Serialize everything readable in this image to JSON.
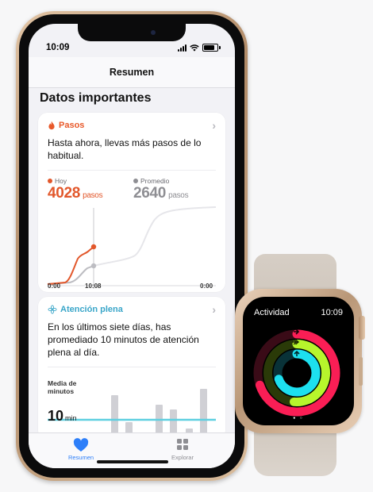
{
  "phone": {
    "status_bar": {
      "time": "10:09"
    },
    "nav_title": "Resumen",
    "section_title": "Datos importantes",
    "steps_card": {
      "category": "Pasos",
      "category_color": "#e8592a",
      "icon": "flame-icon",
      "message": "Hasta ahora, llevas más pasos de lo habitual.",
      "today": {
        "label": "Hoy",
        "value": "4028",
        "unit": "pasos",
        "color": "#e2572b"
      },
      "average": {
        "label": "Promedio",
        "value": "2640",
        "unit": "pasos",
        "color": "#8e8e93"
      },
      "axis": {
        "start": "0:00",
        "marker": "10:08",
        "end": "0:00"
      }
    },
    "mindful_card": {
      "category": "Atención plena",
      "category_color": "#3aa6c9",
      "icon": "mindfulness-icon",
      "message": "En los últimos siete días, has promediado 10 minutos de atención plena al día.",
      "avg_label": "Media de minutos",
      "avg_value": "10",
      "avg_unit": "min"
    },
    "tab_bar": {
      "tabs": [
        {
          "label": "Resumen",
          "icon": "heart-icon",
          "selected": true
        },
        {
          "label": "Explorar",
          "icon": "grid-icon",
          "selected": false
        }
      ]
    }
  },
  "watch": {
    "title": "Actividad",
    "time": "10:09",
    "ring_colors": {
      "move": "#fa1e55",
      "exercise": "#b7f62c",
      "stand": "#1de0ef"
    }
  }
}
